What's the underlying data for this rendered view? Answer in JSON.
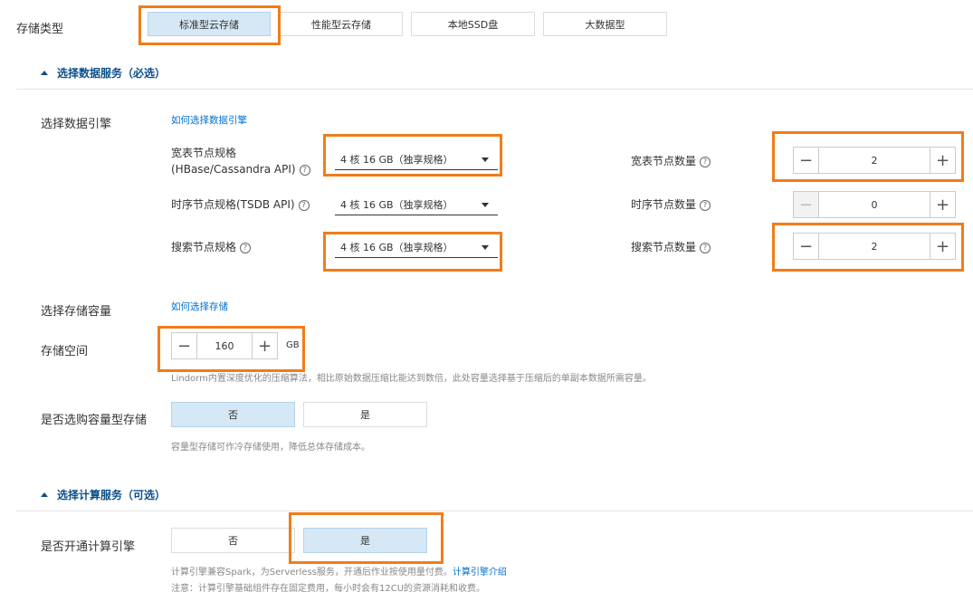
{
  "storage_type": {
    "label": "存储类型",
    "options": [
      "标准型云存储",
      "性能型云存储",
      "本地SSD盘",
      "大数据型"
    ],
    "selected_index": 0
  },
  "data_service": {
    "section_title": "选择数据服务（必选）",
    "engine_label": "选择数据引擎",
    "engine_link": "如何选择数据引擎",
    "rows": [
      {
        "spec_label_line1": "宽表节点规格",
        "spec_label_line2": "(HBase/Cassandra API)",
        "spec_value": "4 核 16 GB（独享规格）",
        "count_label": "宽表节点数量",
        "count_value": "2"
      },
      {
        "spec_label_line1": "时序节点规格(TSDB API)",
        "spec_label_line2": "",
        "spec_value": "4 核 16 GB（独享规格）",
        "count_label": "时序节点数量",
        "count_value": "0"
      },
      {
        "spec_label_line1": "搜索节点规格",
        "spec_label_line2": "",
        "spec_value": "4 核 16 GB（独享规格）",
        "count_label": "搜索节点数量",
        "count_value": "2"
      }
    ],
    "capacity_label": "选择存储容量",
    "capacity_link": "如何选择存储",
    "space_label": "存储空间",
    "space_value": "160",
    "space_unit": "GB",
    "space_hint": "Lindorm内置深度优化的压缩算法，相比原始数据压缩比能达到数倍，此处容量选择基于压缩后的单副本数据所需容量。",
    "cold_label": "是否选购容量型存储",
    "cold_options": [
      "否",
      "是"
    ],
    "cold_selected_index": 0,
    "cold_hint": "容量型存储可作冷存储使用，降低总体存储成本。"
  },
  "compute_service": {
    "section_title": "选择计算服务（可选）",
    "label": "是否开通计算引擎",
    "options": [
      "否",
      "是"
    ],
    "selected_index": 1,
    "hint1": "计算引擎兼容Spark，为Serverless服务，开通后作业按使用量付费。",
    "hint1_link": "计算引擎介绍",
    "hint2": "注意：计算引擎基础组件存在固定费用，每小时会有12CU的资源消耗和收费。"
  },
  "help_icon_glyph": "?"
}
